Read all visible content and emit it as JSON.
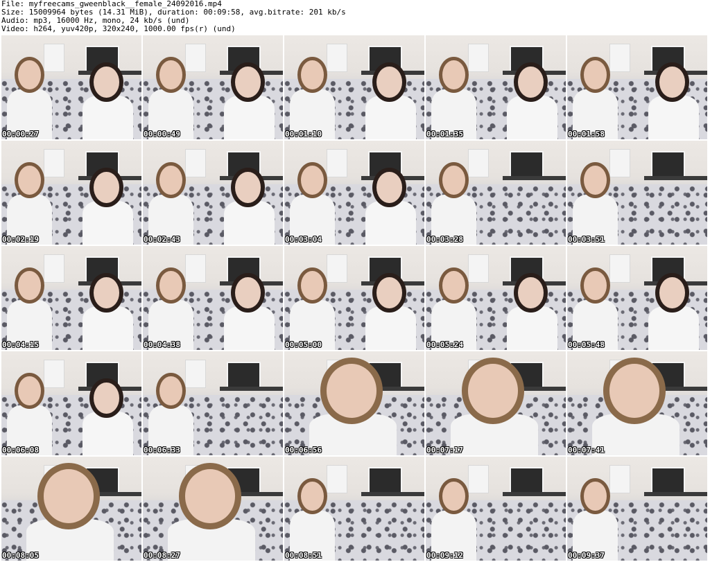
{
  "header": {
    "file": "File: myfreecams_gweenblack__female_24092016.mp4",
    "size": "Size: 15009964 bytes (14.31 MiB), duration: 00:09:58, avg.bitrate: 201 kb/s",
    "audio": "Audio: mp3, 16000 Hz, mono, 24 kb/s (und)",
    "video": "Video: h264, yuv420p, 320x240, 1000.00 fps(r) (und)"
  },
  "thumbnails": [
    {
      "time": "00:00:27",
      "kind": "duo"
    },
    {
      "time": "00:00:49",
      "kind": "duo"
    },
    {
      "time": "00:01:10",
      "kind": "duo"
    },
    {
      "time": "00:01:35",
      "kind": "duo"
    },
    {
      "time": "00:01:58",
      "kind": "duo"
    },
    {
      "time": "00:02:19",
      "kind": "duo"
    },
    {
      "time": "00:02:43",
      "kind": "duo"
    },
    {
      "time": "00:03:04",
      "kind": "duo"
    },
    {
      "time": "00:03:28",
      "kind": "solo"
    },
    {
      "time": "00:03:51",
      "kind": "solo"
    },
    {
      "time": "00:04:15",
      "kind": "duo"
    },
    {
      "time": "00:04:38",
      "kind": "duo"
    },
    {
      "time": "00:05:00",
      "kind": "duo"
    },
    {
      "time": "00:05:24",
      "kind": "duo"
    },
    {
      "time": "00:05:48",
      "kind": "duo"
    },
    {
      "time": "00:06:08",
      "kind": "duo"
    },
    {
      "time": "00:06:33",
      "kind": "solo"
    },
    {
      "time": "00:06:56",
      "kind": "closeup"
    },
    {
      "time": "00:07:17",
      "kind": "closeup"
    },
    {
      "time": "00:07:41",
      "kind": "closeup"
    },
    {
      "time": "00:08:05",
      "kind": "closeup"
    },
    {
      "time": "00:08:27",
      "kind": "closeup"
    },
    {
      "time": "00:08:51",
      "kind": "solo"
    },
    {
      "time": "00:09:12",
      "kind": "solo"
    },
    {
      "time": "00:09:37",
      "kind": "solo"
    }
  ]
}
